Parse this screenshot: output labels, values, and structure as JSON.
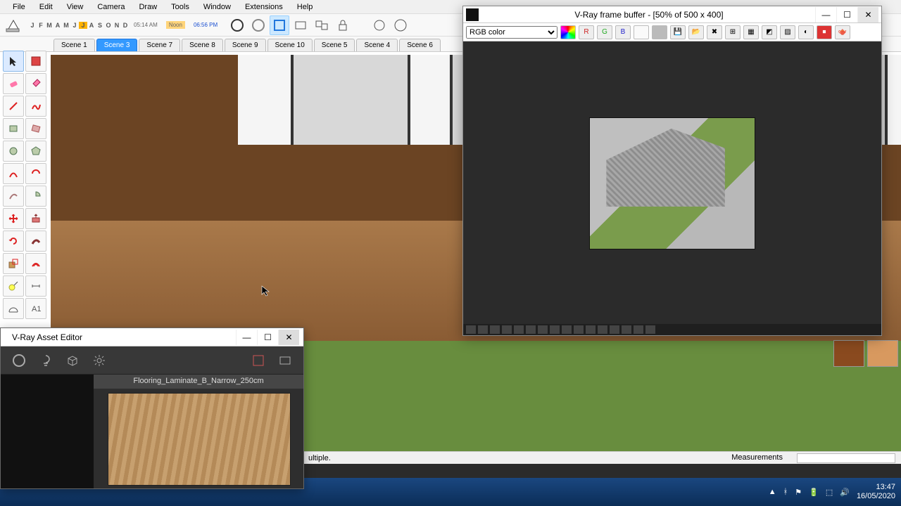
{
  "menu": [
    "File",
    "Edit",
    "View",
    "Camera",
    "Draw",
    "Tools",
    "Window",
    "Extensions",
    "Help"
  ],
  "months": [
    "J",
    "F",
    "M",
    "A",
    "M",
    "J",
    "J",
    "A",
    "S",
    "O",
    "N",
    "D"
  ],
  "times": {
    "start": "05:14 AM",
    "mid": "Noon",
    "end": "06:56 PM"
  },
  "scenes": [
    "Scene 1",
    "Scene 3",
    "Scene 7",
    "Scene 8",
    "Scene 9",
    "Scene 10",
    "Scene 5",
    "Scene 4",
    "Scene 6"
  ],
  "active_scene": 1,
  "status": {
    "left": "ultiple.",
    "measure_label": "Measurements"
  },
  "vfb": {
    "title": "V-Ray frame buffer - [50% of 500 x 400]",
    "channel": "RGB color",
    "btns": [
      "R",
      "G",
      "B"
    ]
  },
  "ae": {
    "title": "V-Ray Asset Editor",
    "material": "Flooring_Laminate_B_Narrow_250cm"
  },
  "swatches": [
    "#8a4a1f",
    "#d8995f"
  ],
  "clock": {
    "time": "13:47",
    "date": "16/05/2020"
  }
}
